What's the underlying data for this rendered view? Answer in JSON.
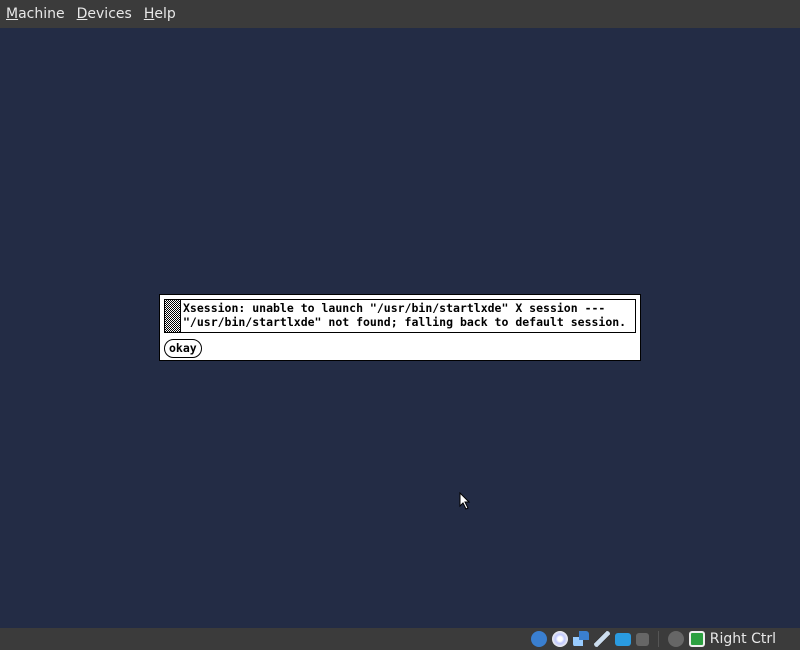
{
  "menubar": {
    "items": [
      {
        "label": "Machine",
        "accel": "M",
        "rest": "achine"
      },
      {
        "label": "Devices",
        "accel": "D",
        "rest": "evices"
      },
      {
        "label": "Help",
        "accel": "H",
        "rest": "elp"
      }
    ]
  },
  "dialog": {
    "message_line1": "Xsession: unable to launch \"/usr/bin/startlxde\" X session ---",
    "message_line2": "\"/usr/bin/startlxde\" not found; falling back to default session.",
    "button_label": "okay"
  },
  "statusbar": {
    "icons": [
      "hard-disk-icon",
      "optical-drive-icon",
      "network-icon",
      "usb-icon",
      "shared-folder-icon",
      "virtualization-icon",
      "mouse-integration-icon",
      "keyboard-capture-icon"
    ],
    "host_key": "Right Ctrl"
  }
}
